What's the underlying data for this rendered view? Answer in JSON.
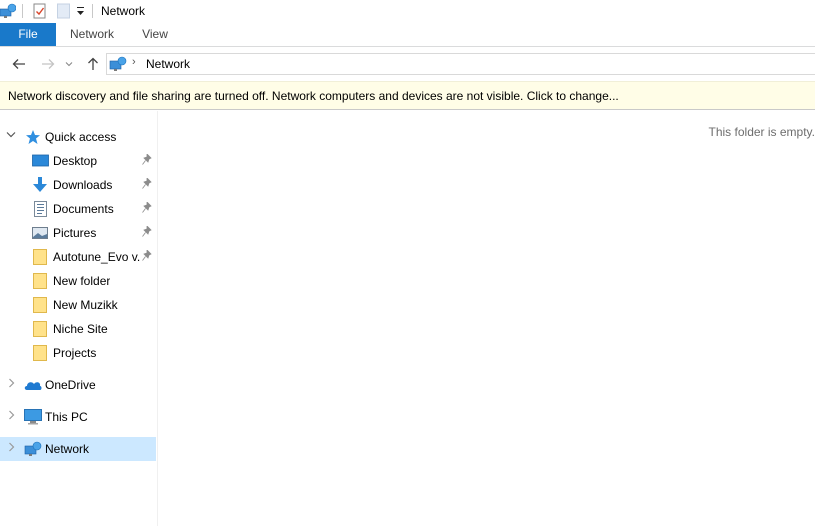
{
  "window": {
    "title": "Network",
    "qat_icons": [
      "network-icon",
      "properties-icon",
      "new-folder-icon",
      "customize-qat-icon"
    ]
  },
  "ribbon": {
    "tabs": [
      {
        "label": "File",
        "active": true
      },
      {
        "label": "Network",
        "active": false
      },
      {
        "label": "View",
        "active": false
      }
    ]
  },
  "navigation": {
    "back_icon": "arrow-left-icon",
    "forward_icon": "arrow-right-icon",
    "recent_icon": "chevron-down-icon",
    "up_icon": "arrow-up-icon",
    "address": {
      "icon": "network-icon",
      "separator": "›",
      "path": "Network"
    }
  },
  "infobar": {
    "message": "Network discovery and file sharing are turned off. Network computers and devices are not visible. Click to change..."
  },
  "sidebar": {
    "quick_access": {
      "label": "Quick access",
      "expanded": true,
      "items": [
        {
          "label": "Desktop",
          "icon": "desktop-icon",
          "pinned": true
        },
        {
          "label": "Downloads",
          "icon": "downloads-icon",
          "pinned": true
        },
        {
          "label": "Documents",
          "icon": "documents-icon",
          "pinned": true
        },
        {
          "label": "Pictures",
          "icon": "pictures-icon",
          "pinned": true
        },
        {
          "label": "Autotune_Evo v.",
          "icon": "folder-icon",
          "pinned": true
        },
        {
          "label": "New folder",
          "icon": "folder-icon",
          "pinned": false
        },
        {
          "label": "New Muzikk",
          "icon": "folder-icon",
          "pinned": false
        },
        {
          "label": "Niche Site",
          "icon": "folder-icon",
          "pinned": false
        },
        {
          "label": "Projects",
          "icon": "folder-icon",
          "pinned": false
        }
      ]
    },
    "roots": [
      {
        "label": "OneDrive",
        "icon": "onedrive-icon",
        "selected": false
      },
      {
        "label": "This PC",
        "icon": "this-pc-icon",
        "selected": false
      },
      {
        "label": "Network",
        "icon": "network-icon",
        "selected": true
      }
    ]
  },
  "content": {
    "empty_message": "This folder is empty."
  },
  "colors": {
    "file_tab": "#1979ca",
    "selection": "#cce8ff",
    "infobar_bg": "#fffde7",
    "accent_blue": "#2b88d8"
  }
}
